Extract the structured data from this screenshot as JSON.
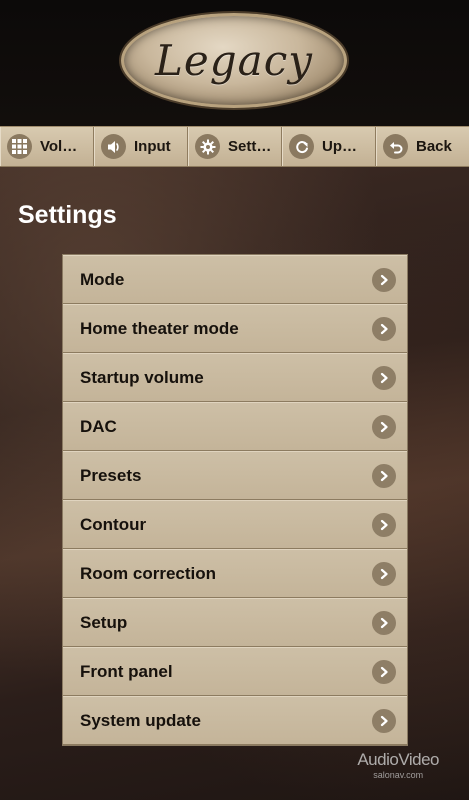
{
  "header": {
    "logo_text": "Legacy"
  },
  "toolbar": {
    "items": [
      {
        "label": "Vol…",
        "icon": "grid-icon"
      },
      {
        "label": "Input",
        "icon": "speaker-icon"
      },
      {
        "label": "Sett…",
        "icon": "gear-icon"
      },
      {
        "label": "Up…",
        "icon": "refresh-icon"
      },
      {
        "label": "Back",
        "icon": "back-arrow-icon"
      }
    ]
  },
  "main": {
    "title": "Settings",
    "items": [
      {
        "label": "Mode"
      },
      {
        "label": "Home theater mode"
      },
      {
        "label": "Startup volume"
      },
      {
        "label": "DAC"
      },
      {
        "label": "Presets"
      },
      {
        "label": "Contour"
      },
      {
        "label": "Room correction"
      },
      {
        "label": "Setup"
      },
      {
        "label": "Front panel"
      },
      {
        "label": "System update"
      }
    ]
  },
  "watermark": {
    "main": "AudioVideo",
    "sub": "salonav.com"
  },
  "colors": {
    "toolbar_bg": "#c9b99d",
    "list_item_bg": "#c4b499",
    "icon_circle": "#8a7960"
  }
}
